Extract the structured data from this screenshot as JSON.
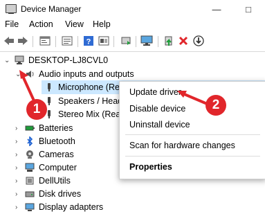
{
  "window": {
    "title": "Device Manager",
    "controls": {
      "minimize": "—",
      "maximize": "□"
    }
  },
  "menu": {
    "items": [
      "File",
      "Action",
      "View",
      "Help"
    ]
  },
  "toolbar": {
    "icons": [
      "back-icon",
      "forward-icon",
      "properties-icon",
      "show-hidden-icon",
      "help-icon",
      "action-icon",
      "update-driver-icon",
      "monitor-icon",
      "add-driver-icon",
      "uninstall-icon",
      "download-icon"
    ],
    "accent_green": "#1e9e3a",
    "accent_red": "#e1262b"
  },
  "tree": {
    "root": "DESKTOP-LJ8CVL0",
    "expanded_category": "Audio inputs and outputs",
    "children": [
      {
        "label": "Microphone (Realtek(R) Audio)",
        "selected": true
      },
      {
        "label": "Speakers / Headphones (Realtek(R) Audio)",
        "selected": false
      },
      {
        "label": "Stereo Mix (Realtek(R) Audio)",
        "selected": false
      }
    ],
    "categories": [
      "Batteries",
      "Bluetooth",
      "Cameras",
      "Computer",
      "DellUtils",
      "Disk drives",
      "Display adapters"
    ]
  },
  "context_menu": {
    "items": [
      "Update driver",
      "Disable device",
      "Uninstall device",
      "Scan for hardware changes",
      "Properties"
    ],
    "bold_item": "Properties"
  },
  "annotations": {
    "badge1": "1",
    "badge2": "2",
    "color": "#e1262b"
  }
}
